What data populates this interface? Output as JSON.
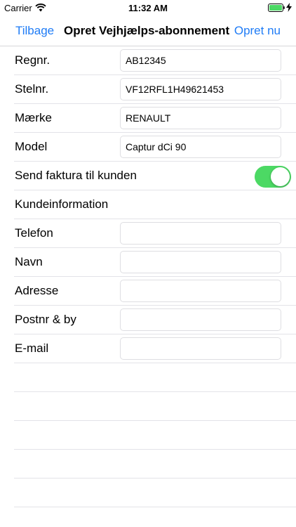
{
  "status_bar": {
    "carrier": "Carrier",
    "time": "11:32 AM",
    "wifi_icon": "wifi-icon",
    "battery_icon": "battery-icon"
  },
  "nav": {
    "back_label": "Tilbage",
    "title": "Opret Vejhjælps-abonnement",
    "action_label": "Opret nu"
  },
  "colors": {
    "accent": "#1f7cf6",
    "switch_on": "#4cd964"
  },
  "form": {
    "regnr": {
      "label": "Regnr.",
      "value": "AB12345"
    },
    "stelnr": {
      "label": "Stelnr.",
      "value": "VF12RFL1H49621453"
    },
    "maerke": {
      "label": "Mærke",
      "value": "RENAULT"
    },
    "model": {
      "label": "Model",
      "value": "Captur dCi 90"
    },
    "send_invoice": {
      "label": "Send faktura til kunden",
      "on": true
    },
    "customer_section": {
      "label": "Kundeinformation"
    },
    "telefon": {
      "label": "Telefon",
      "value": ""
    },
    "navn": {
      "label": "Navn",
      "value": ""
    },
    "adresse": {
      "label": "Adresse",
      "value": ""
    },
    "postnr": {
      "label": "Postnr & by",
      "value": ""
    },
    "email": {
      "label": "E-mail",
      "value": ""
    }
  }
}
